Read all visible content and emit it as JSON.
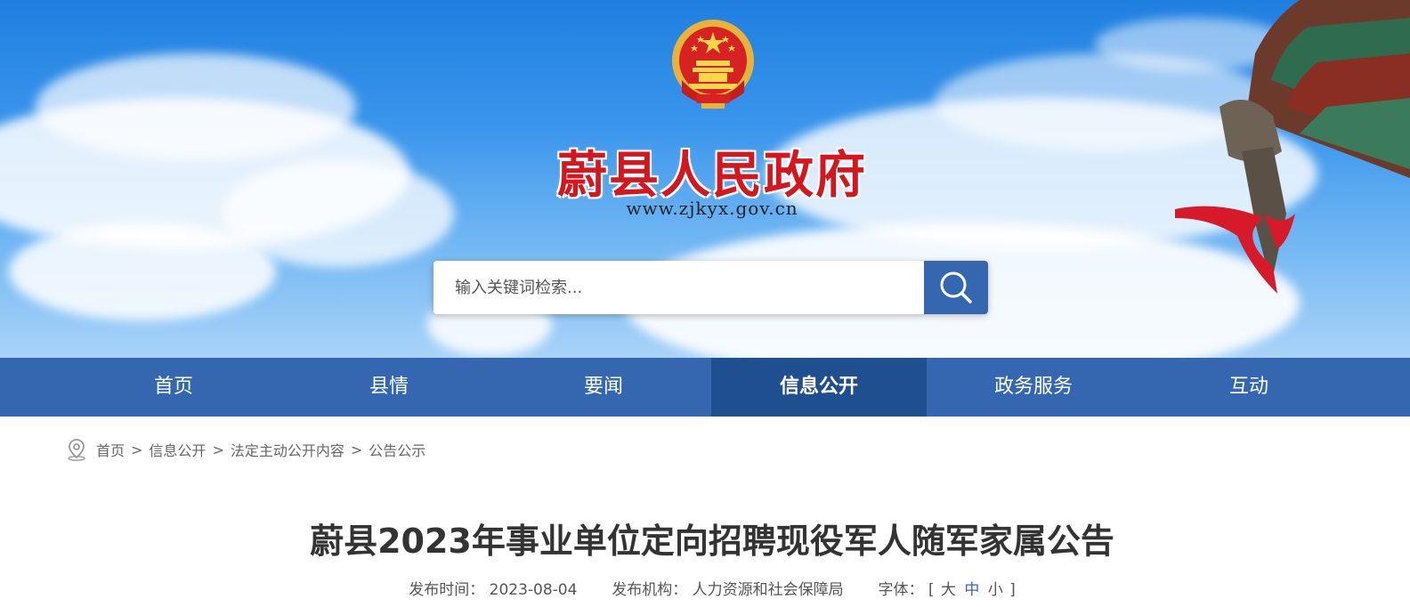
{
  "header": {
    "site_title": "蔚县人民政府",
    "site_url": "www.zjkyx.gov.cn",
    "emblem_icon": "national-emblem-icon",
    "search": {
      "placeholder": "输入关键词检索...",
      "value": "",
      "button_icon": "search-icon"
    }
  },
  "nav": {
    "items": [
      {
        "label": "首页",
        "active": false
      },
      {
        "label": "县情",
        "active": false
      },
      {
        "label": "要闻",
        "active": false
      },
      {
        "label": "信息公开",
        "active": true
      },
      {
        "label": "政务服务",
        "active": false
      },
      {
        "label": "互动",
        "active": false
      }
    ],
    "colors": {
      "bar": "#3467b0",
      "active": "#1f4f8f"
    }
  },
  "breadcrumb": {
    "icon": "location-pin-icon",
    "items": [
      "首页",
      "信息公开",
      "法定主动公开内容",
      "公告公示"
    ],
    "separator": ">"
  },
  "article": {
    "title": "蔚县2023年事业单位定向招聘现役军人随军家属公告",
    "publish_time_label": "发布时间：",
    "publish_time": "2023-08-04",
    "publisher_label": "发布机构：",
    "publisher": "人力资源和社会保障局",
    "font_size_label": "字体：",
    "font_open": "[",
    "font_large": "大",
    "font_medium": "中",
    "font_small": "小",
    "font_close": "]"
  },
  "colors": {
    "title_red": "#d4171e",
    "accent_blue": "#3467b0"
  }
}
